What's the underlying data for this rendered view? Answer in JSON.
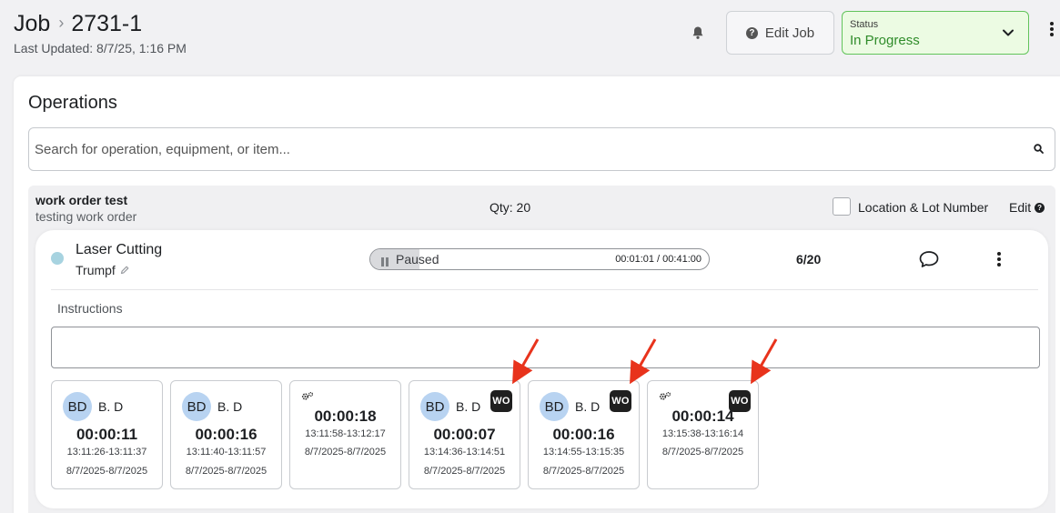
{
  "header": {
    "crumb_root": "Job",
    "crumb_job": "2731-1",
    "last_updated": "Last Updated: 8/7/25, 1:16 PM",
    "edit_job_label": "Edit Job",
    "status_label": "Status",
    "status_value": "In Progress"
  },
  "operations": {
    "title": "Operations",
    "search_placeholder": "Search for operation, equipment, or item...",
    "work_order": {
      "name": "work order test",
      "description": "testing work order",
      "qty": "Qty: 20",
      "location_label": "Location & Lot Number",
      "edit_label": "Edit"
    },
    "operation": {
      "name": "Laser Cutting",
      "equipment": "Trumpf",
      "state": "Paused",
      "progress_fraction": 0.0244,
      "time": "00:01:01 / 00:41:00",
      "count": "6/20",
      "instructions_label": "Instructions",
      "instructions_value": ""
    },
    "logs": [
      {
        "kind": "user",
        "initials": "BD",
        "user": "B. D",
        "badge": "",
        "duration": "00:00:11",
        "range": "13:11:26-13:11:37",
        "dates": "8/7/2025-8/7/2025"
      },
      {
        "kind": "user",
        "initials": "BD",
        "user": "B. D",
        "badge": "",
        "duration": "00:00:16",
        "range": "13:11:40-13:11:57",
        "dates": "8/7/2025-8/7/2025"
      },
      {
        "kind": "machine",
        "initials": "",
        "user": "",
        "badge": "",
        "duration": "00:00:18",
        "range": "13:11:58-13:12:17",
        "dates": "8/7/2025-8/7/2025"
      },
      {
        "kind": "user",
        "initials": "BD",
        "user": "B. D",
        "badge": "WO",
        "duration": "00:00:07",
        "range": "13:14:36-13:14:51",
        "dates": "8/7/2025-8/7/2025"
      },
      {
        "kind": "user",
        "initials": "BD",
        "user": "B. D",
        "badge": "WO",
        "duration": "00:00:16",
        "range": "13:14:55-13:15:35",
        "dates": "8/7/2025-8/7/2025"
      },
      {
        "kind": "machine",
        "initials": "",
        "user": "",
        "badge": "WO",
        "duration": "00:00:14",
        "range": "13:15:38-13:16:14",
        "dates": "8/7/2025-8/7/2025"
      }
    ]
  },
  "colors": {
    "status_border": "#62c45b",
    "status_bg": "#ecfbe3",
    "status_text": "#2f8c2a",
    "avatar_bg": "#b8d3f1",
    "annotation_arrow": "#e8331c"
  }
}
